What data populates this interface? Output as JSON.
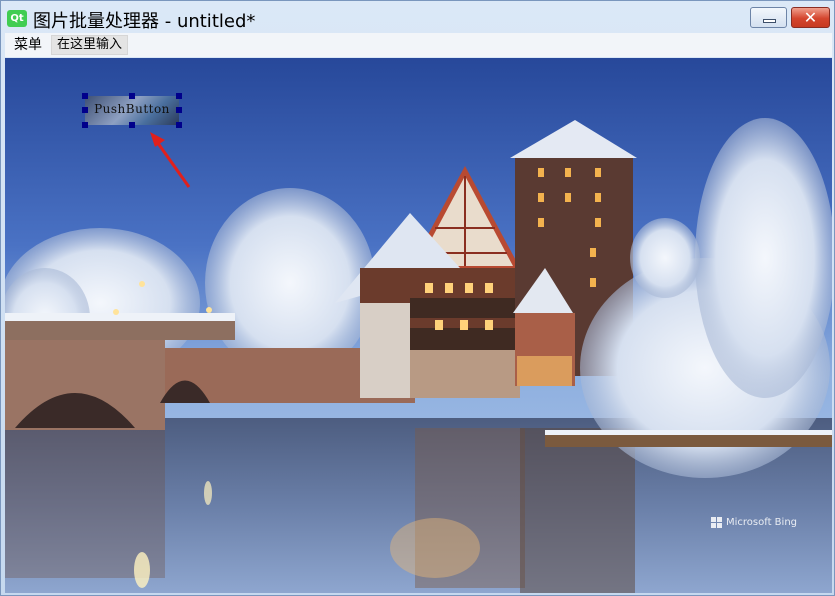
{
  "window": {
    "app_icon_text": "Qt",
    "title": "图片批量处理器 - untitled*",
    "close_symbol": "✕"
  },
  "menubar": {
    "items": [
      "菜单",
      "在这里输入"
    ]
  },
  "canvas": {
    "selected_item_text": "PushButton",
    "watermark": "Microsoft Bing"
  },
  "colors": {
    "handle": "#00008b",
    "arrow": "#e0201c",
    "app_icon": "#41cd52"
  },
  "icons": [
    "qt-app-icon",
    "minimize-icon",
    "close-icon",
    "microsoft-logo-icon"
  ]
}
